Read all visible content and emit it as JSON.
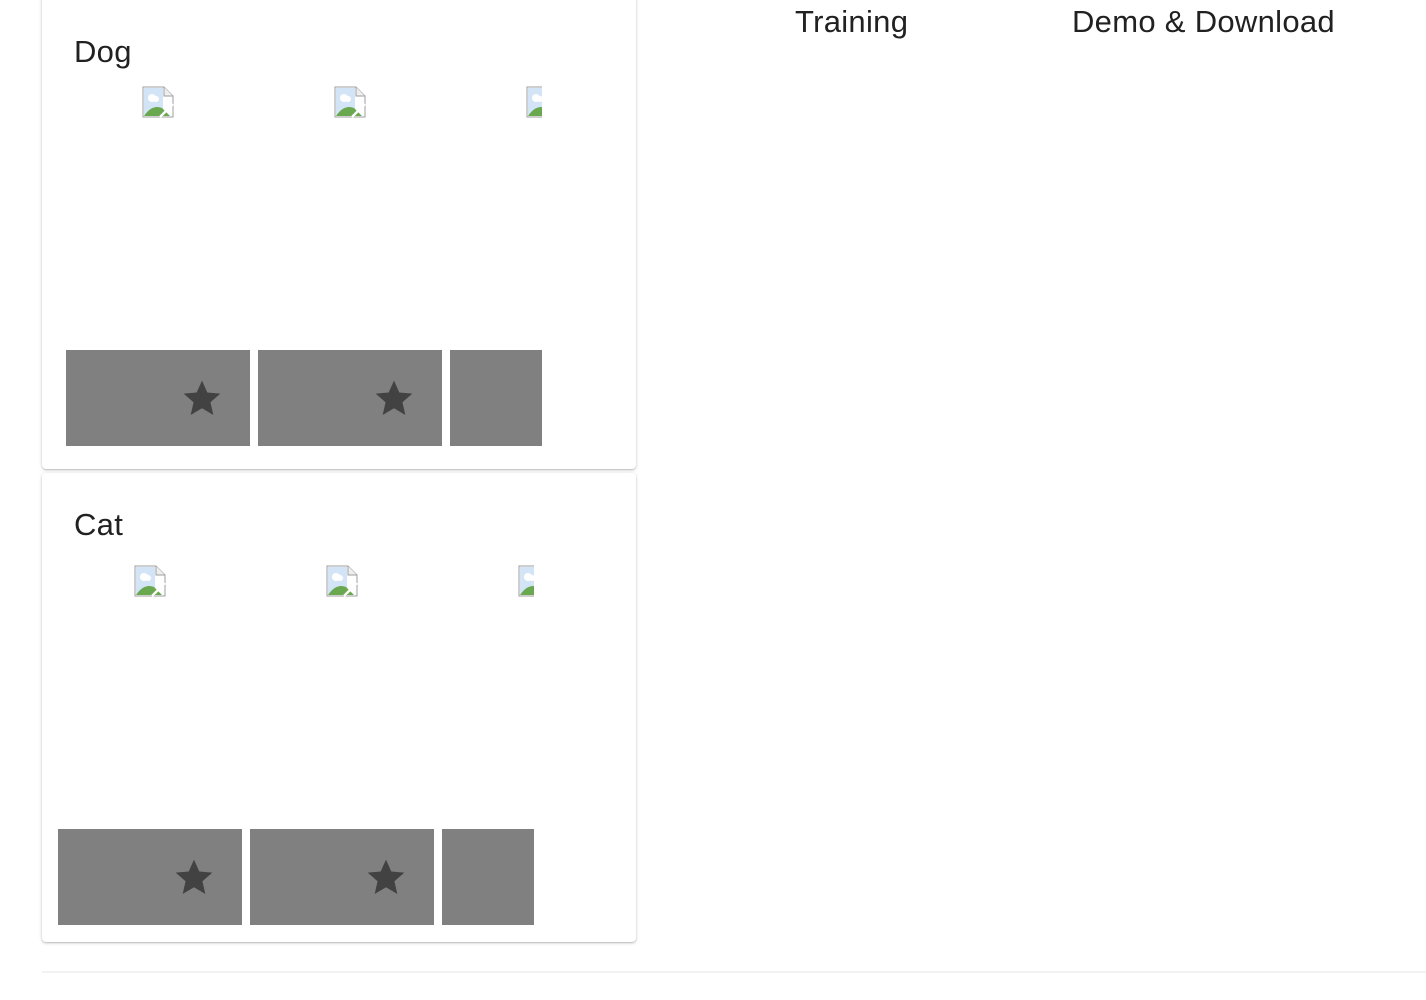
{
  "tabs": {
    "training": "Training",
    "demo_download": "Demo & Download"
  },
  "categories": [
    {
      "title": "Dog",
      "tiles": [
        {
          "icon": "broken-image-icon",
          "action_icon": "star-icon"
        },
        {
          "icon": "broken-image-icon",
          "action_icon": "star-icon"
        },
        {
          "icon": "broken-image-icon",
          "action_icon": "star-icon"
        }
      ]
    },
    {
      "title": "Cat",
      "tiles": [
        {
          "icon": "broken-image-icon",
          "action_icon": "star-icon"
        },
        {
          "icon": "broken-image-icon",
          "action_icon": "star-icon"
        },
        {
          "icon": "broken-image-icon",
          "action_icon": "star-icon"
        }
      ]
    }
  ],
  "colors": {
    "tile_bar": "#808080",
    "star": "#424242",
    "text": "#212121"
  }
}
